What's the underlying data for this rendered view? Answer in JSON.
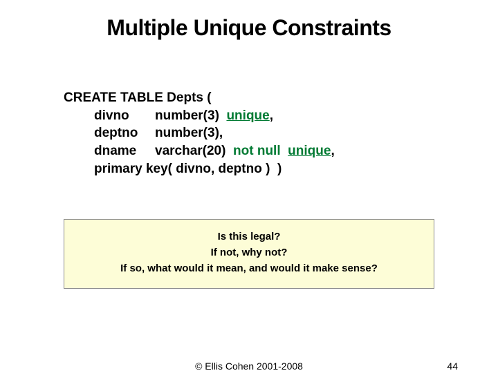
{
  "title": "Multiple Unique Constraints",
  "code": {
    "line1": "CREATE TABLE Depts (",
    "divno_col": "divno",
    "divno_type": "number(3)  ",
    "unique1": "unique",
    "comma1": ",",
    "deptno_col": "deptno",
    "deptno_type": "number(3),",
    "dname_col": "dname",
    "dname_type": "varchar(20)  ",
    "notnull": "not null  ",
    "unique2": "unique",
    "comma2": ",",
    "pk": "primary key( divno, deptno )  )"
  },
  "questions": {
    "q1": "Is this legal?",
    "q2": "If not, why not?",
    "q3": "If so, what would it mean, and would it make sense?"
  },
  "footer": {
    "copyright": "© Ellis Cohen 2001-2008",
    "page": "44"
  }
}
